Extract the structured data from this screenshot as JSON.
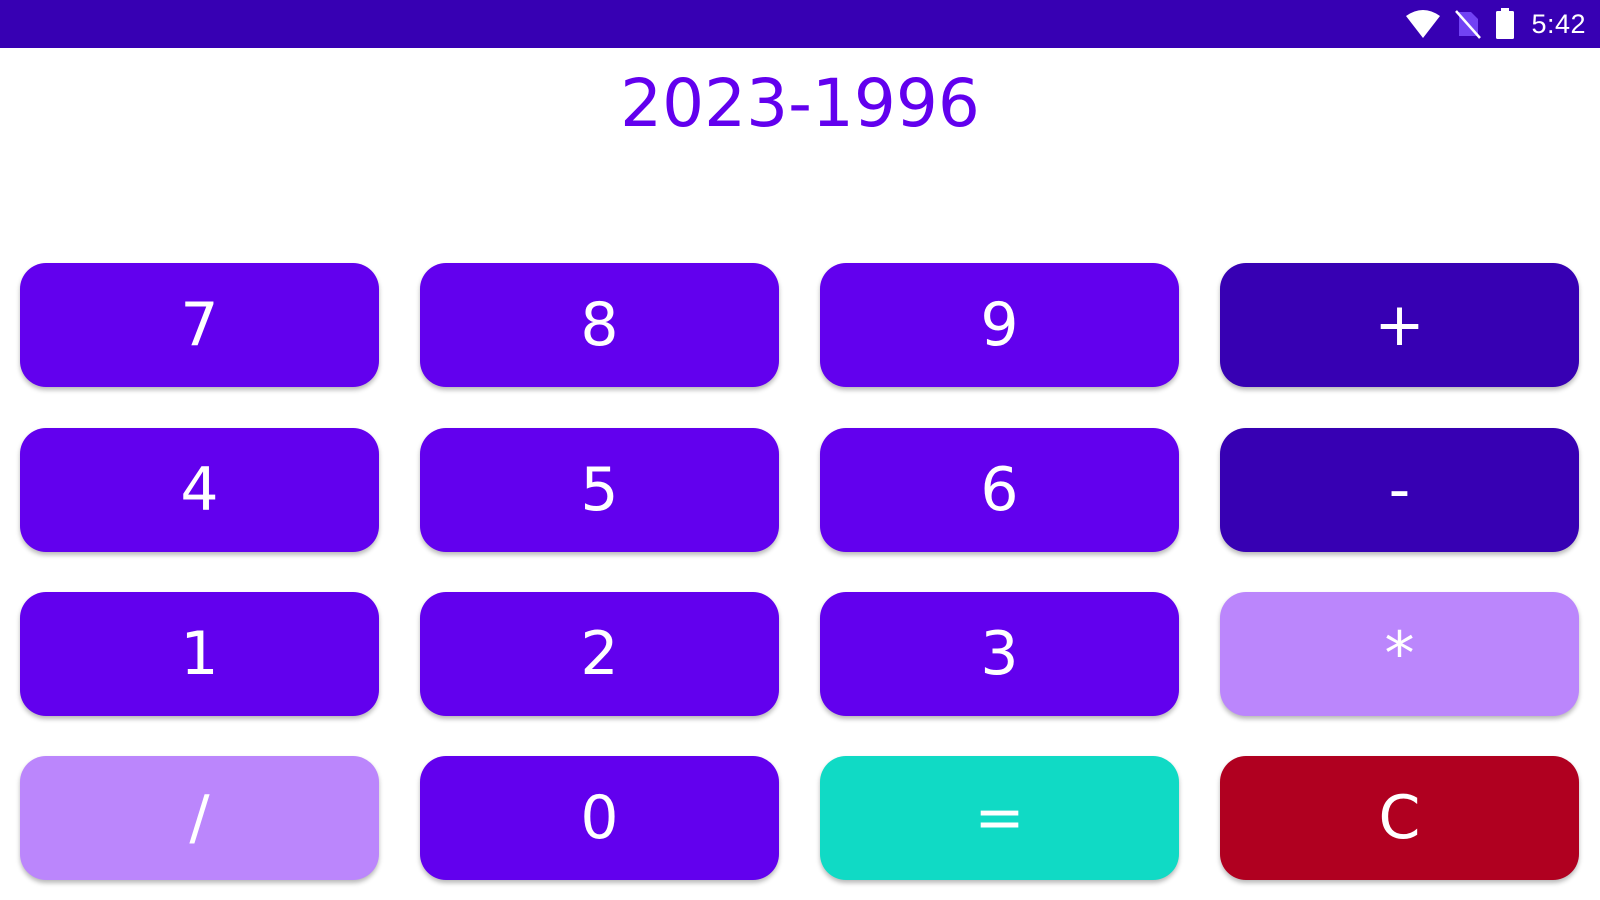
{
  "status_bar": {
    "time": "5:42",
    "background": "#3700b3",
    "icons": [
      "wifi-icon",
      "no-sim-icon",
      "battery-icon"
    ]
  },
  "display": {
    "expression": "2023-1996",
    "color": "#6200ee"
  },
  "colors": {
    "digit": "#6200ee",
    "add_sub": "#3700b3",
    "mul_div": "#bb86fc",
    "equals": "#10dac5",
    "clear": "#b00020"
  },
  "keys": {
    "seven": "7",
    "eight": "8",
    "nine": "9",
    "plus": "+",
    "four": "4",
    "five": "5",
    "six": "6",
    "minus": "-",
    "one": "1",
    "two": "2",
    "three": "3",
    "multiply": "*",
    "divide": "/",
    "zero": "0",
    "equals": "=",
    "clear": "C"
  }
}
